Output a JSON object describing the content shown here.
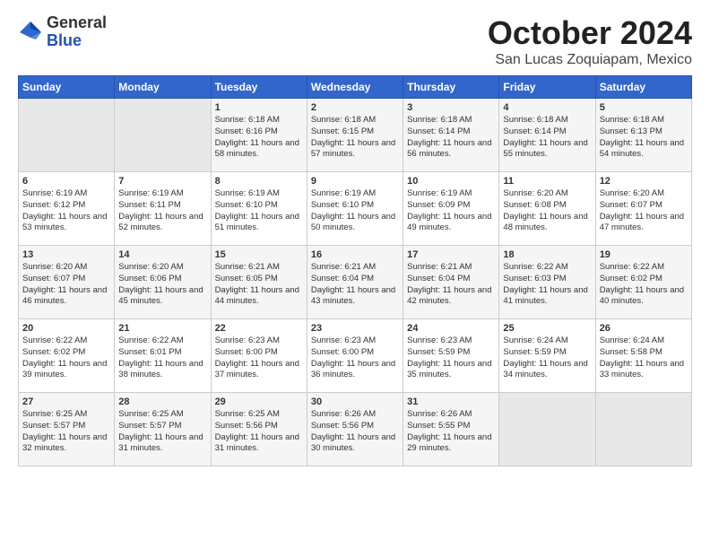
{
  "header": {
    "logo_general": "General",
    "logo_blue": "Blue",
    "month_title": "October 2024",
    "location": "San Lucas Zoquiapam, Mexico"
  },
  "days_of_week": [
    "Sunday",
    "Monday",
    "Tuesday",
    "Wednesday",
    "Thursday",
    "Friday",
    "Saturday"
  ],
  "weeks": [
    [
      {
        "day": "",
        "info": ""
      },
      {
        "day": "",
        "info": ""
      },
      {
        "day": "1",
        "info": "Sunrise: 6:18 AM\nSunset: 6:16 PM\nDaylight: 11 hours and 58 minutes."
      },
      {
        "day": "2",
        "info": "Sunrise: 6:18 AM\nSunset: 6:15 PM\nDaylight: 11 hours and 57 minutes."
      },
      {
        "day": "3",
        "info": "Sunrise: 6:18 AM\nSunset: 6:14 PM\nDaylight: 11 hours and 56 minutes."
      },
      {
        "day": "4",
        "info": "Sunrise: 6:18 AM\nSunset: 6:14 PM\nDaylight: 11 hours and 55 minutes."
      },
      {
        "day": "5",
        "info": "Sunrise: 6:18 AM\nSunset: 6:13 PM\nDaylight: 11 hours and 54 minutes."
      }
    ],
    [
      {
        "day": "6",
        "info": "Sunrise: 6:19 AM\nSunset: 6:12 PM\nDaylight: 11 hours and 53 minutes."
      },
      {
        "day": "7",
        "info": "Sunrise: 6:19 AM\nSunset: 6:11 PM\nDaylight: 11 hours and 52 minutes."
      },
      {
        "day": "8",
        "info": "Sunrise: 6:19 AM\nSunset: 6:10 PM\nDaylight: 11 hours and 51 minutes."
      },
      {
        "day": "9",
        "info": "Sunrise: 6:19 AM\nSunset: 6:10 PM\nDaylight: 11 hours and 50 minutes."
      },
      {
        "day": "10",
        "info": "Sunrise: 6:19 AM\nSunset: 6:09 PM\nDaylight: 11 hours and 49 minutes."
      },
      {
        "day": "11",
        "info": "Sunrise: 6:20 AM\nSunset: 6:08 PM\nDaylight: 11 hours and 48 minutes."
      },
      {
        "day": "12",
        "info": "Sunrise: 6:20 AM\nSunset: 6:07 PM\nDaylight: 11 hours and 47 minutes."
      }
    ],
    [
      {
        "day": "13",
        "info": "Sunrise: 6:20 AM\nSunset: 6:07 PM\nDaylight: 11 hours and 46 minutes."
      },
      {
        "day": "14",
        "info": "Sunrise: 6:20 AM\nSunset: 6:06 PM\nDaylight: 11 hours and 45 minutes."
      },
      {
        "day": "15",
        "info": "Sunrise: 6:21 AM\nSunset: 6:05 PM\nDaylight: 11 hours and 44 minutes."
      },
      {
        "day": "16",
        "info": "Sunrise: 6:21 AM\nSunset: 6:04 PM\nDaylight: 11 hours and 43 minutes."
      },
      {
        "day": "17",
        "info": "Sunrise: 6:21 AM\nSunset: 6:04 PM\nDaylight: 11 hours and 42 minutes."
      },
      {
        "day": "18",
        "info": "Sunrise: 6:22 AM\nSunset: 6:03 PM\nDaylight: 11 hours and 41 minutes."
      },
      {
        "day": "19",
        "info": "Sunrise: 6:22 AM\nSunset: 6:02 PM\nDaylight: 11 hours and 40 minutes."
      }
    ],
    [
      {
        "day": "20",
        "info": "Sunrise: 6:22 AM\nSunset: 6:02 PM\nDaylight: 11 hours and 39 minutes."
      },
      {
        "day": "21",
        "info": "Sunrise: 6:22 AM\nSunset: 6:01 PM\nDaylight: 11 hours and 38 minutes."
      },
      {
        "day": "22",
        "info": "Sunrise: 6:23 AM\nSunset: 6:00 PM\nDaylight: 11 hours and 37 minutes."
      },
      {
        "day": "23",
        "info": "Sunrise: 6:23 AM\nSunset: 6:00 PM\nDaylight: 11 hours and 36 minutes."
      },
      {
        "day": "24",
        "info": "Sunrise: 6:23 AM\nSunset: 5:59 PM\nDaylight: 11 hours and 35 minutes."
      },
      {
        "day": "25",
        "info": "Sunrise: 6:24 AM\nSunset: 5:59 PM\nDaylight: 11 hours and 34 minutes."
      },
      {
        "day": "26",
        "info": "Sunrise: 6:24 AM\nSunset: 5:58 PM\nDaylight: 11 hours and 33 minutes."
      }
    ],
    [
      {
        "day": "27",
        "info": "Sunrise: 6:25 AM\nSunset: 5:57 PM\nDaylight: 11 hours and 32 minutes."
      },
      {
        "day": "28",
        "info": "Sunrise: 6:25 AM\nSunset: 5:57 PM\nDaylight: 11 hours and 31 minutes."
      },
      {
        "day": "29",
        "info": "Sunrise: 6:25 AM\nSunset: 5:56 PM\nDaylight: 11 hours and 31 minutes."
      },
      {
        "day": "30",
        "info": "Sunrise: 6:26 AM\nSunset: 5:56 PM\nDaylight: 11 hours and 30 minutes."
      },
      {
        "day": "31",
        "info": "Sunrise: 6:26 AM\nSunset: 5:55 PM\nDaylight: 11 hours and 29 minutes."
      },
      {
        "day": "",
        "info": ""
      },
      {
        "day": "",
        "info": ""
      }
    ]
  ]
}
